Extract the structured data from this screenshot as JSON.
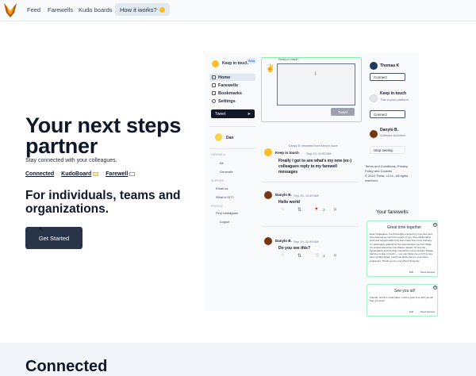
{
  "nav": {
    "links": [
      "Feed",
      "Farewells",
      "Kudo boards"
    ],
    "how_it_works": "How it works?"
  },
  "hero": {
    "title": "Your next steps partner",
    "subtitle": "Stay connected with your colleagues.",
    "links": [
      "Connected",
      "KudoBoard",
      "Farewell"
    ],
    "heading": "For individuals, teams and organizations.",
    "cta": "Get Started"
  },
  "mock": {
    "brand": "Keep in touch",
    "beta": "Beta",
    "sidebar": [
      "Home",
      "Farewells",
      "Bookmarks",
      "Settings"
    ],
    "tweet_button": "Tweet",
    "user": "Dan",
    "sections": [
      {
        "title": "FAREWELL",
        "items": [
          "All",
          "Generate"
        ]
      },
      {
        "title": "SUPPORT",
        "items": [
          "Email us",
          "What is KIT?"
        ]
      },
      {
        "title": "PROFILE",
        "items": [
          "Find colleagues",
          "Logout"
        ]
      }
    ],
    "compose": {
      "placeholder": "Ready to share?",
      "button": "Tweet"
    },
    "posts": [
      {
        "retweet_note": "Danylo B. retweeted from Keep in touch",
        "author": "Keep in touch",
        "time": "Sep 19, 11:53 AM",
        "text": "Finally I got to see what's my new (ex-) colleagues reply to my farewell messages"
      },
      {
        "author": "Danylo B.",
        "time": "Sep 19, 11:49 AM",
        "text": "Hello world",
        "likes": "2"
      },
      {
        "author": "Danylo B.",
        "time": "Sep 19, 11:49 AM",
        "text": "Do you see this?",
        "likes": "1"
      }
    ],
    "right_panel": {
      "people": [
        {
          "name": "Thomas K",
          "button": "Connect"
        },
        {
          "name": "Keep in touch",
          "sub": "This is your platform",
          "button": "Connect"
        },
        {
          "name": "Danylo B.",
          "sub": "Software Architect",
          "button": "Stop seeing"
        }
      ],
      "footer_links": "Terms and Conditions, Privacy Policy and Cookies",
      "copyright": "© 2024 Theta, LLCs., All rights reserved."
    },
    "farewells": {
      "title": "Your farewells",
      "cards": [
        {
          "title": "Great time together",
          "text": "Dear Colleagues, I've thoroughly enjoyed my time here and have learned so much from each of you. The collaborative spirit and support within this team have been truly inspiring. I'm particularly grateful for the opportunities I've had. While I'm excited about the new chapter ahead, I'll miss the camaraderie and the daily interactions we've shared. Please feel free to stay in touch — you can follow me on KIT or any other profiles listed. I wish you all the best in your future endeavors. Thank you for everything! Sincerely,",
          "actions": [
            "Edit",
            "Send preview"
          ]
        },
        {
          "title": "See you all!",
          "text": "Friends, Scroll to small place, I had a great time with you all! See you soon!",
          "actions": [
            "Edit",
            "Send preview"
          ]
        }
      ]
    }
  },
  "section2": {
    "title": "Connected"
  }
}
